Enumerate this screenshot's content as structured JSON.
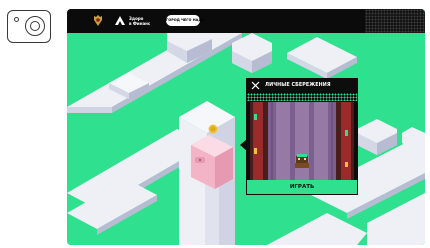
{
  "toolbar": {
    "camera_icon": "camera-icon"
  },
  "game": {
    "header": {
      "emblem_icon": "coat-of-arms-icon",
      "logo_line1": "Здоро",
      "logo_line2": "в Финанс",
      "pill_label": "ГОРОД ЧЕГО НАДО"
    },
    "modal": {
      "title": "ЛИЧНЫЕ СБЕРЕЖЕНИЯ",
      "close_icon": "close-icon",
      "play_label": "ИГРАТЬ"
    }
  },
  "colors": {
    "background_green": "#2fe08e",
    "building_white": "#eef0f6",
    "pig_pink": "#f6c8d6",
    "modal_black": "#0d0d0d",
    "screen_purple": "#8a6b9b"
  }
}
